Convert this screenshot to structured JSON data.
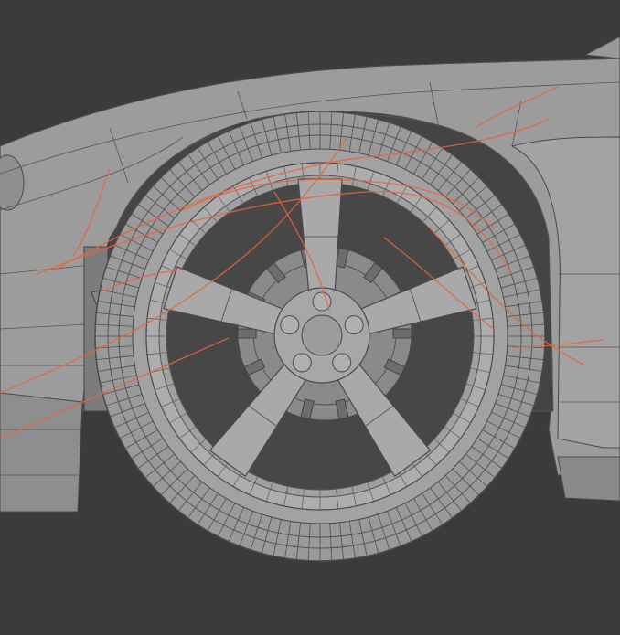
{
  "scene": {
    "background": "#3b3b3b",
    "mesh_fill": "#9d9d9d",
    "mesh_light": "#b4b4b4",
    "mesh_dark": "#6e6e6e",
    "wire_color": "#4a4a4a",
    "selection_color": "#e8643c",
    "lug_nut_count": 5,
    "spoke_count": 5
  }
}
